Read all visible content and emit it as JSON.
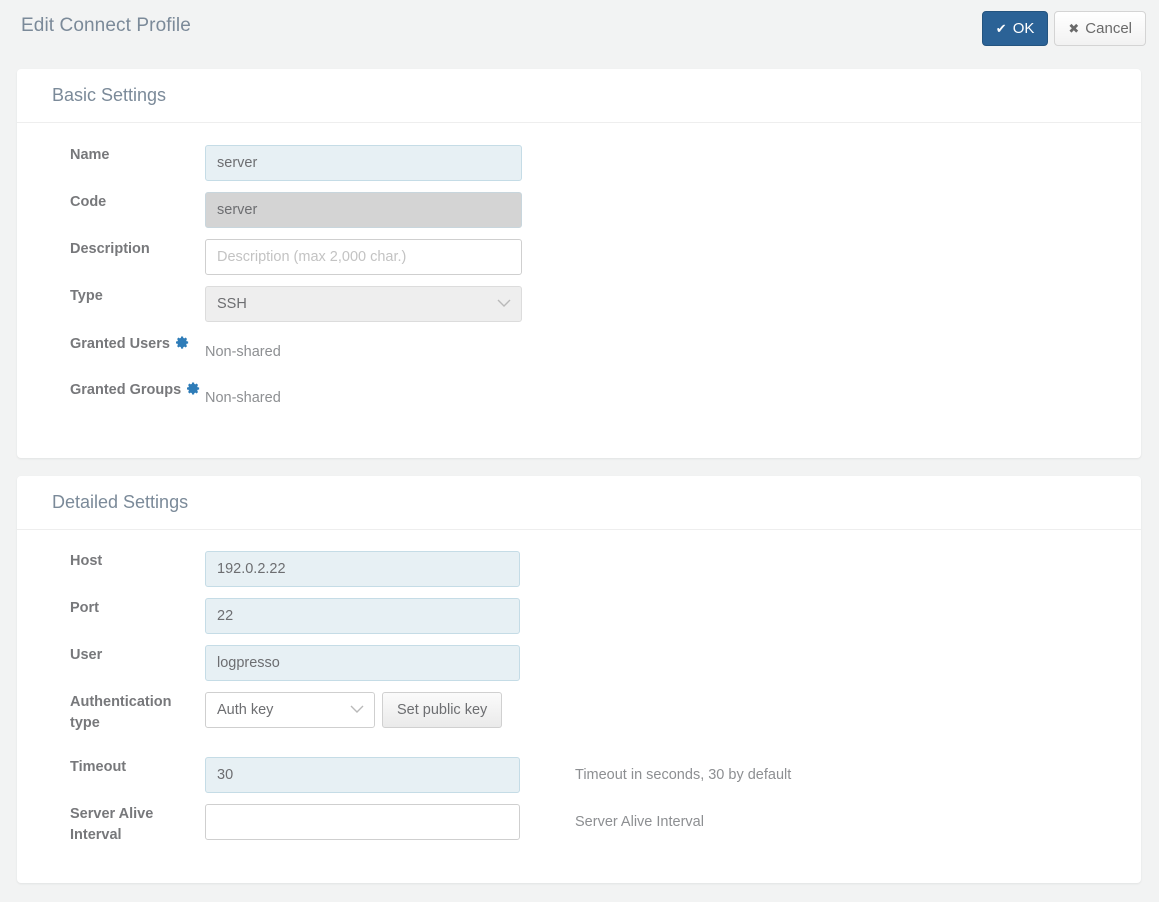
{
  "header": {
    "title": "Edit Connect Profile",
    "ok_label": "OK",
    "cancel_label": "Cancel",
    "ok_icon": "check-icon",
    "cancel_icon": "close-icon",
    "ok_color": "#2b6296"
  },
  "basic": {
    "title": "Basic Settings",
    "name": {
      "label": "Name",
      "value": "server"
    },
    "code": {
      "label": "Code",
      "value": "server"
    },
    "description": {
      "label": "Description",
      "value": "",
      "placeholder": "Description (max 2,000 char.)"
    },
    "type": {
      "label": "Type",
      "value": "SSH"
    },
    "granted_users": {
      "label": "Granted Users",
      "value": "Non-shared",
      "icon": "gear-icon"
    },
    "granted_groups": {
      "label": "Granted Groups",
      "value": "Non-shared",
      "icon": "gear-icon"
    }
  },
  "detailed": {
    "title": "Detailed Settings",
    "host": {
      "label": "Host",
      "value": "192.0.2.22"
    },
    "port": {
      "label": "Port",
      "value": "22"
    },
    "user": {
      "label": "User",
      "value": "logpresso"
    },
    "auth_type": {
      "label": "Authentication type",
      "value": "Auth key",
      "button_label": "Set public key"
    },
    "timeout": {
      "label": "Timeout",
      "value": "30",
      "help": "Timeout in seconds, 30 by default"
    },
    "server_alive_interval": {
      "label": "Server Alive Interval",
      "value": "",
      "help": "Server Alive Interval"
    }
  }
}
